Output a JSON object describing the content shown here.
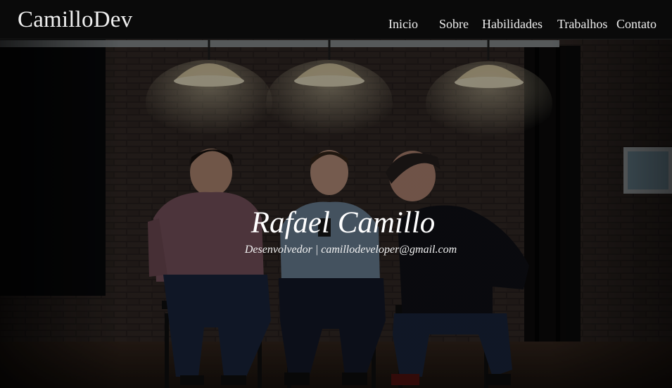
{
  "navbar": {
    "brand": "CamilloDev",
    "links": [
      {
        "label": "Inicio"
      },
      {
        "label": "Sobre"
      },
      {
        "label": "Habilidades"
      },
      {
        "label": "Trabalhos"
      },
      {
        "label": "Contato"
      }
    ]
  },
  "hero": {
    "title": "Rafael Camillo",
    "subtitle": "Desenvolvedor | camillodeveloper@gmail.com"
  }
}
